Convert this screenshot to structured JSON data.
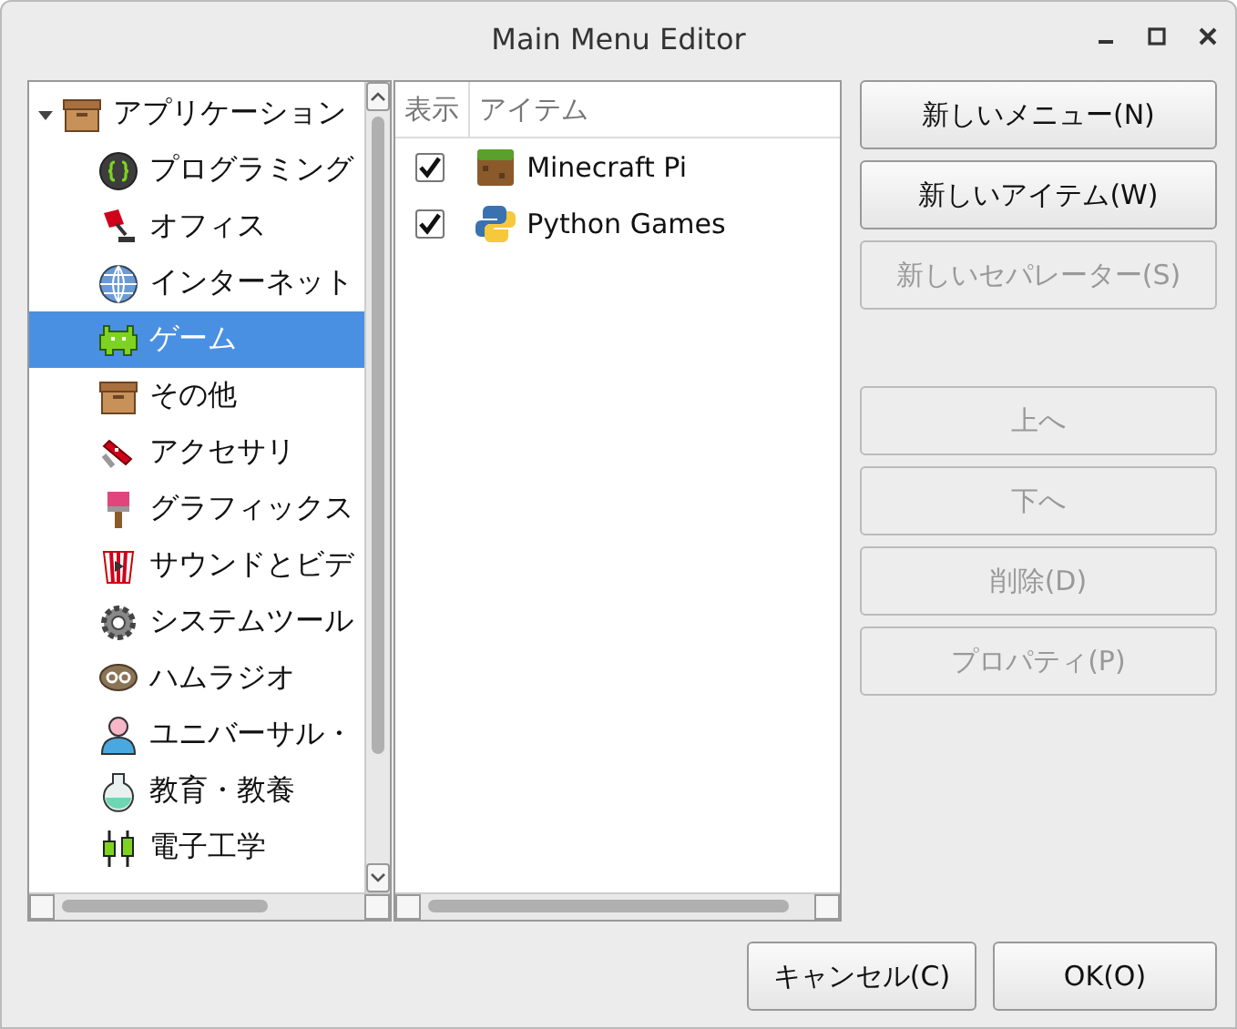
{
  "window": {
    "title": "Main Menu Editor"
  },
  "tree": [
    {
      "label": "アプリケーション",
      "expanded": true,
      "selected": false,
      "children": [
        {
          "label": "プログラミング",
          "selected": false
        },
        {
          "label": "オフィス",
          "selected": false
        },
        {
          "label": "インターネット",
          "selected": false
        },
        {
          "label": "ゲーム",
          "selected": true
        },
        {
          "label": "その他",
          "selected": false
        },
        {
          "label": "アクセサリ",
          "selected": false
        },
        {
          "label": "グラフィックス",
          "selected": false
        },
        {
          "label": "サウンドとビデ",
          "selected": false
        },
        {
          "label": "システムツール",
          "selected": false
        },
        {
          "label": "ハムラジオ",
          "selected": false
        },
        {
          "label": "ユニバーサル・",
          "selected": false
        },
        {
          "label": "教育・教養",
          "selected": false
        },
        {
          "label": "電子工学",
          "selected": false
        }
      ]
    }
  ],
  "items": {
    "columns": [
      "表示",
      "アイテム"
    ],
    "rows": [
      {
        "name": "Minecraft Pi",
        "checked": true
      },
      {
        "name": "Python Games",
        "checked": true
      }
    ]
  },
  "buttons": [
    {
      "label": "新しいメニュー(N)",
      "disabled": false
    },
    {
      "label": "新しいアイテム(W)",
      "disabled": false
    },
    {
      "label": "新しいセパレーター(S)",
      "disabled": true
    },
    {
      "label": "上へ",
      "disabled": true
    },
    {
      "label": "下へ",
      "disabled": true
    },
    {
      "label": "削除(D)",
      "disabled": true
    },
    {
      "label": "プロパティ(P)",
      "disabled": true
    }
  ],
  "footer": [
    {
      "label": "キャンセル(C)"
    },
    {
      "label": "OK(O)"
    }
  ]
}
